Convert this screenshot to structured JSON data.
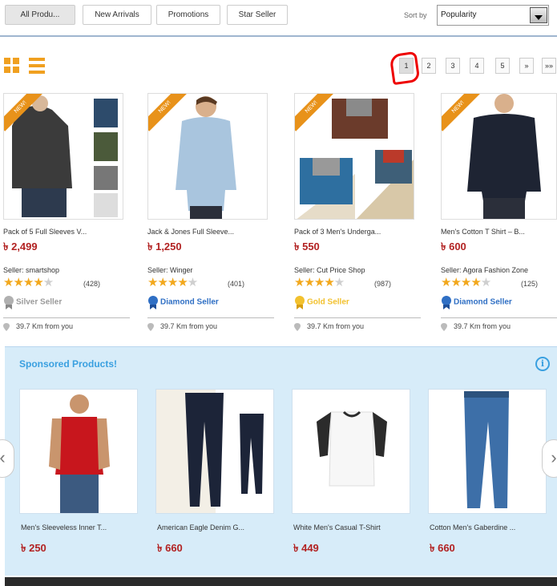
{
  "filter_bar": {
    "buttons": [
      "All Produ...",
      "New Arrivals",
      "Promotions",
      "Star Seller"
    ],
    "sort_label": "Sort by",
    "sort_value": "Popularity"
  },
  "pagination": {
    "pages": [
      "1",
      "2",
      "3",
      "4",
      "5",
      "»",
      "»»"
    ],
    "current": "1"
  },
  "new_badge": "NEW!",
  "products": [
    {
      "name": "Pack of 5 Full Sleeves V...",
      "price": "৳ 2,499",
      "seller": "Seller: smartshop",
      "rating": 3.5,
      "rating_count": "(428)",
      "tier": "Silver Seller",
      "tier_color": "#9a9a9a",
      "distance": "39.7 Km from you"
    },
    {
      "name": "Jack & Jones Full Sleeve...",
      "price": "৳ 1,250",
      "seller": "Seller: Winger",
      "rating": 4,
      "rating_count": "(401)",
      "tier": "Diamond Seller",
      "tier_color": "#2f6fc4",
      "distance": "39.7 Km from you"
    },
    {
      "name": "Pack of 3 Men's Underga...",
      "price": "৳ 550",
      "seller": "Seller: Cut Price Shop",
      "rating": 4,
      "rating_count": "(987)",
      "tier": "Gold Seller",
      "tier_color": "#f2c12e",
      "distance": "39.7 Km from you"
    },
    {
      "name": "Men's Cotton T Shirt – B...",
      "price": "৳ 600",
      "seller": "Seller: Agora Fashion Zone",
      "rating": 4,
      "rating_count": "(125)",
      "tier": "Diamond Seller",
      "tier_color": "#2f6fc4",
      "distance": "39.7 Km from you"
    }
  ],
  "sponsored": {
    "title": "Sponsored Products!",
    "info_icon": "i",
    "prev_icon": "‹",
    "next_icon": "›",
    "items": [
      {
        "name": "Men's Sleeveless Inner T...",
        "price": "৳ 250"
      },
      {
        "name": "American Eagle Denim G...",
        "price": "৳ 660"
      },
      {
        "name": "White Men's Casual T-Shirt",
        "price": "৳ 449"
      },
      {
        "name": "Cotton Men's Gaberdine ...",
        "price": "৳ 660"
      }
    ]
  },
  "colors": {
    "accent_orange": "#f0a020",
    "price_red": "#b22222",
    "sponsored_bg": "#d7ecf9",
    "sponsored_title": "#3aa0e0"
  }
}
